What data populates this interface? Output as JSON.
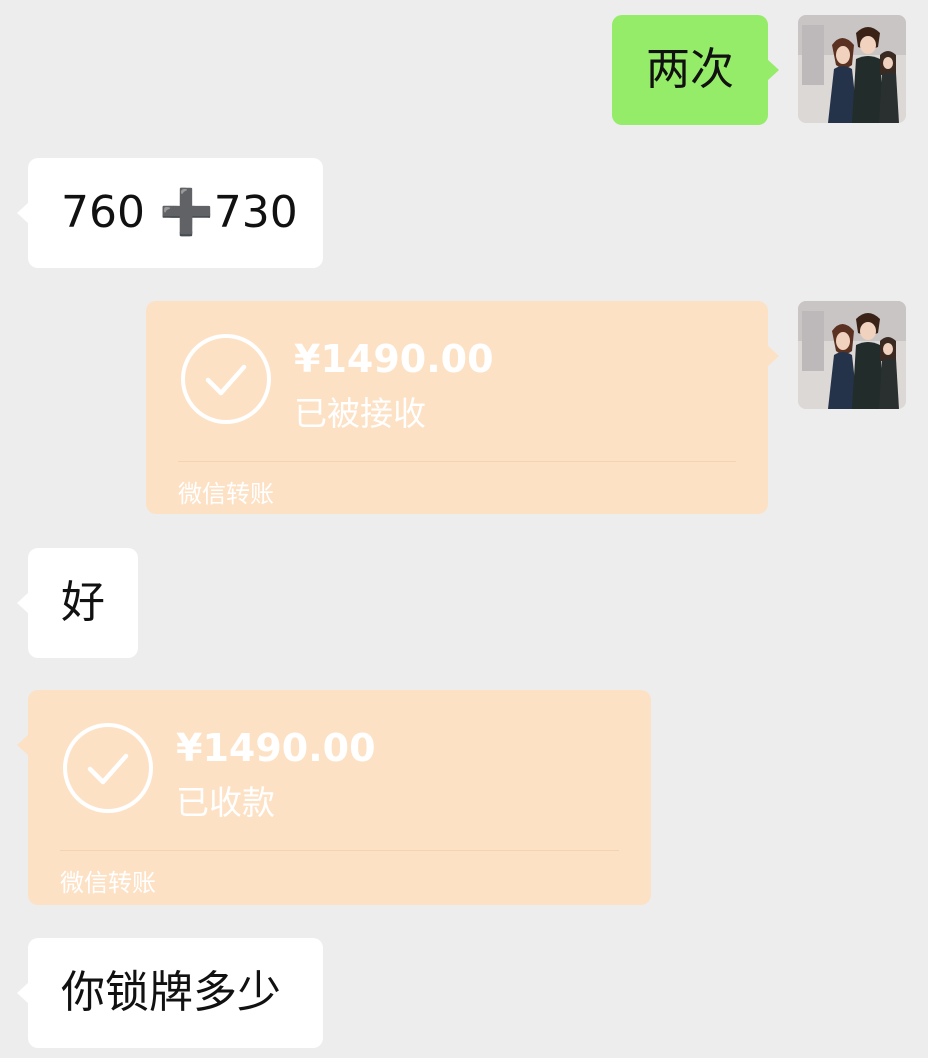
{
  "messages": [
    {
      "text": "两次"
    },
    {
      "text": "760 ➕730"
    },
    {
      "amount": "¥1490.00",
      "status": "已被接收",
      "footer": "微信转账"
    },
    {
      "text": "好"
    },
    {
      "amount": "¥1490.00",
      "status": "已收款",
      "footer": "微信转账"
    },
    {
      "text": "你锁牌多少"
    }
  ],
  "colors": {
    "background": "#ededed",
    "outgoing_bubble": "#95ec69",
    "incoming_bubble": "#ffffff",
    "transfer_card": "#fde1c5"
  }
}
